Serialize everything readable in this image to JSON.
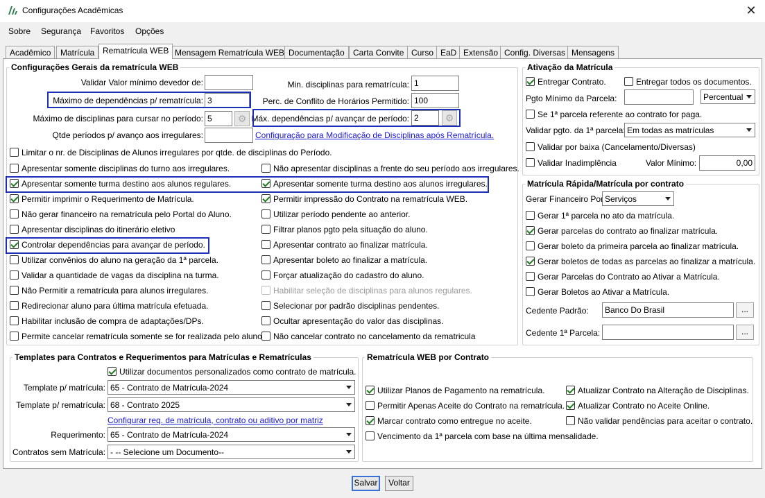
{
  "window": {
    "title": "Configurações Acadêmicas",
    "close_glyph": "✕"
  },
  "menu": [
    "Sobre",
    "Segurança",
    "Favoritos",
    "Opções"
  ],
  "tabs": [
    "Acadêmico",
    "Matrícula",
    "Rematrícula WEB",
    "Mensagem Rematrícula WEB",
    "Documentação",
    "Carta Convite",
    "Curso",
    "EaD",
    "Extensão",
    "Config. Diversas",
    "Mensagens"
  ],
  "active_tab": "Rematrícula WEB",
  "geral": {
    "legend": "Configurações Gerais da rematrícula WEB",
    "valor_minimo_label": "Validar Valor mínimo devedor de:",
    "valor_minimo_value": "",
    "max_dep_label": "Máximo de dependências p/ rematrícula:",
    "max_dep_value": "3",
    "max_disc_label": "Máximo de disciplinas para cursar no período:",
    "max_disc_value": "5",
    "qtde_periodos_label": "Qtde períodos p/ avanço aos irregulares:",
    "qtde_periodos_value": "",
    "min_disc_label": "Min. disciplinas para rematrícula:",
    "min_disc_value": "1",
    "perc_conflito_label": "Perc. de Conflito de Horários Permitido:",
    "perc_conflito_value": "100",
    "max_dep_avancar_label": "Máx. dependências p/ avançar de período:",
    "max_dep_avancar_value": "2",
    "config_link": "Configuração para Modificação de Disciplinas após Rematrícula.",
    "limitar_label": "Limitar o nr. de Disciplinas de Alunos irregulares por qtde. de disciplinas do Período.",
    "left_checks": [
      {
        "label": "Apresentar somente disciplinas do turno aos irregulares.",
        "checked": false
      },
      {
        "label": "Apresentar somente turma destino aos alunos regulares.",
        "checked": true
      },
      {
        "label": "Permitir imprimir o Requerimento de Matrícula.",
        "checked": true
      },
      {
        "label": "Não gerar financeiro na rematrícula pelo Portal do Aluno.",
        "checked": false
      },
      {
        "label": "Apresentar disciplinas do itinerário eletivo",
        "checked": false
      },
      {
        "label": "Controlar dependências para avançar de período.",
        "checked": true
      },
      {
        "label": "Utilizar convênios do aluno na geração da 1ª parcela.",
        "checked": false
      },
      {
        "label": "Validar a quantidade de vagas da disciplina na turma.",
        "checked": false
      },
      {
        "label": "Não Permitir a rematrícula para alunos irregulares.",
        "checked": false
      },
      {
        "label": "Redirecionar aluno para última matrícula efetuada.",
        "checked": false
      },
      {
        "label": "Habilitar inclusão de compra de adaptações/DPs.",
        "checked": false
      },
      {
        "label": "Permite cancelar rematrícula somente se for realizada pelo aluno.",
        "checked": false
      }
    ],
    "right_checks": [
      {
        "label": "Não apresentar disciplinas a frente do seu período aos irregulares.",
        "checked": false
      },
      {
        "label": "Apresentar somente turma destino aos alunos irregulares.",
        "checked": true
      },
      {
        "label": "Permitir impressão do Contrato na rematrícula WEB.",
        "checked": true
      },
      {
        "label": "Utilizar período pendente ao anterior.",
        "checked": false
      },
      {
        "label": "Filtrar planos pgto pela situação do aluno.",
        "checked": false
      },
      {
        "label": "Apresentar contrato ao finalizar matrícula.",
        "checked": false
      },
      {
        "label": "Apresentar boleto ao finalizar a matrícula.",
        "checked": false
      },
      {
        "label": "Forçar atualização do cadastro do aluno.",
        "checked": false
      },
      {
        "label": "Habilitar seleção de disciplinas para alunos regulares.",
        "checked": false,
        "disabled": true
      },
      {
        "label": "Selecionar por padrão disciplinas pendentes.",
        "checked": false
      },
      {
        "label": "Ocultar apresentação do valor das disciplinas.",
        "checked": false
      },
      {
        "label": "Não cancelar contrato no cancelamento da rematricula",
        "checked": false
      }
    ]
  },
  "ativacao": {
    "legend": "Ativação da Matrícula",
    "entregar_contrato": "Entregar Contrato.",
    "entregar_todos": "Entregar todos os documentos.",
    "pgto_minimo_label": "Pgto Mínimo da Parcela:",
    "pgto_minimo_value": "",
    "percentual_option": "Percentual",
    "se_parcela_label": "Se 1ª parcela referente ao contrato for paga.",
    "validar_pgto_label": "Validar pgto. da 1ª parcela:",
    "validar_pgto_option": "Em todas as matrículas",
    "validar_baixa_label": "Validar por baixa (Cancelamento/Diversas)",
    "validar_inadimplencia_label": "Validar Inadimplência",
    "valor_minimo_label": "Valor Mínimo:",
    "valor_minimo_value": "0,00"
  },
  "rapida": {
    "legend": "Matrícula Rápida/Matrícula por contrato",
    "gerar_financeiro_label": "Gerar Financeiro Por:",
    "gerar_financeiro_option": "Serviços",
    "checks": [
      {
        "label": "Gerar 1ª parcela no ato da matrícula.",
        "checked": false
      },
      {
        "label": "Gerar parcelas do contrato ao finalizar matrícula.",
        "checked": true
      },
      {
        "label": "Gerar boleto da primeira parcela ao finalizar matrícula.",
        "checked": false
      },
      {
        "label": "Gerar boletos de todas as parcelas ao finalizar a matrícula.",
        "checked": true
      },
      {
        "label": "Gerar Parcelas do Contrato ao Ativar a Matrícula.",
        "checked": false
      },
      {
        "label": "Gerar Boletos ao Ativar a Matrícula.",
        "checked": false
      }
    ],
    "cedente_padrao_label": "Cedente Padrão:",
    "cedente_padrao_value": "Banco Do Brasil",
    "cedente_parcela_label": "Cedente 1ª Parcela:",
    "cedente_parcela_value": "",
    "dots": "..."
  },
  "templates": {
    "legend": "Templates para Contratos e Requerimentos para Matrículas e Rematrículas",
    "utilizar_label": "Utilizar documentos personalizados como contrato de matrícula.",
    "template_matricula_label": "Template p/ matrícula:",
    "template_matricula_value": "65 - Contrato de Matrícula-2024",
    "template_rematricula_label": "Template p/ rematrícula:",
    "template_rematricula_value": "68 - Contrato 2025",
    "config_link": "Configurar req. de matrícula, contrato ou aditivo por matriz",
    "requerimento_label": "Requerimento:",
    "requerimento_value": "65 - Contrato de Matrícula-2024",
    "contratos_sem_label": "Contratos sem Matrícula:",
    "contratos_sem_value": "- -- Selecione um Documento--"
  },
  "contrato_web": {
    "legend": "Rematrícula WEB por Contrato",
    "left_checks": [
      {
        "label": "Utilizar Planos de Pagamento na rematrícula.",
        "checked": true
      },
      {
        "label": "Permitir Apenas Aceite do Contrato na rematrícula.",
        "checked": false
      },
      {
        "label": "Marcar contrato como entregue no aceite.",
        "checked": true
      },
      {
        "label": "Vencimento da 1ª parcela com base na última mensalidade.",
        "checked": false
      }
    ],
    "right_checks": [
      {
        "label": "Atualizar Contrato na Alteração de Disciplinas.",
        "checked": true
      },
      {
        "label": "Atualizar Contrato no Aceite Online.",
        "checked": true
      },
      {
        "label": "Não validar pendências para aceitar o contrato.",
        "checked": false
      }
    ]
  },
  "buttons": {
    "salvar": "Salvar",
    "voltar": "Voltar"
  }
}
